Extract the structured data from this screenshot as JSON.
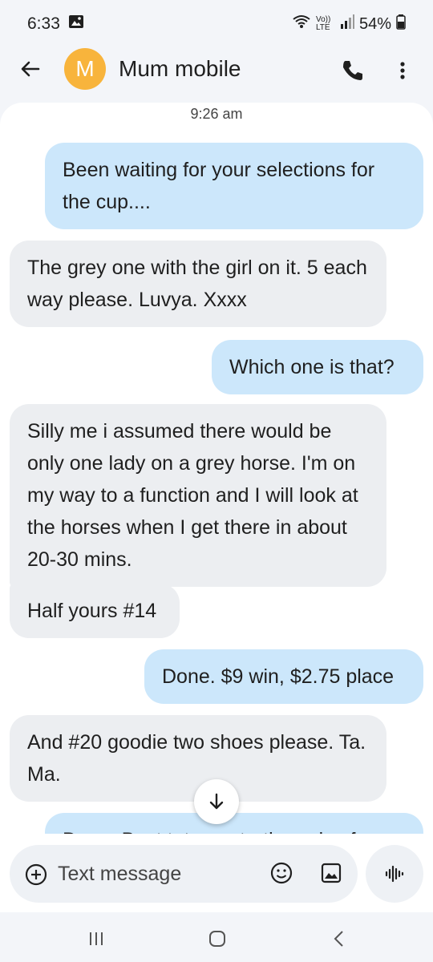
{
  "status_bar": {
    "time": "6:33",
    "network_label": "Vo)) LTE",
    "battery": "54%"
  },
  "header": {
    "avatar_letter": "M",
    "contact_name": "Mum mobile",
    "avatar_color": "#f8b43c"
  },
  "conversation": {
    "timestamp": "9:26 am",
    "messages": [
      {
        "direction": "sent",
        "text": "Been waiting for your selections for the cup...."
      },
      {
        "direction": "received",
        "text": "The grey one with the girl on it. 5 each way please. Luvya. Xxxx"
      },
      {
        "direction": "sent",
        "text": "Which one is that?"
      },
      {
        "direction": "received",
        "text": "Silly me i assumed there would be only one lady on a grey horse. I'm on my way to a function and I will look at the horses when I get there in about 20-30 mins."
      },
      {
        "direction": "received",
        "text": "Half yours #14"
      },
      {
        "direction": "sent",
        "text": "Done. $9 win, $2.75 place"
      },
      {
        "direction": "received",
        "text": "And #20 goodie two shoes please. Ta. Ma."
      },
      {
        "direction": "sent",
        "text": "Done. Best tote or starting price for"
      }
    ]
  },
  "composer": {
    "placeholder": "Text message"
  },
  "colors": {
    "sent_bubble": "#cce7fb",
    "received_bubble": "#eceef1",
    "background": "#f3f5f9"
  },
  "icons": {
    "back": "arrow-back-icon",
    "call": "phone-icon",
    "more": "more-vert-icon",
    "scroll": "arrow-down-icon",
    "add": "add-circle-icon",
    "emoji": "emoji-icon",
    "gallery": "image-icon",
    "voice": "voice-waveform-icon"
  }
}
